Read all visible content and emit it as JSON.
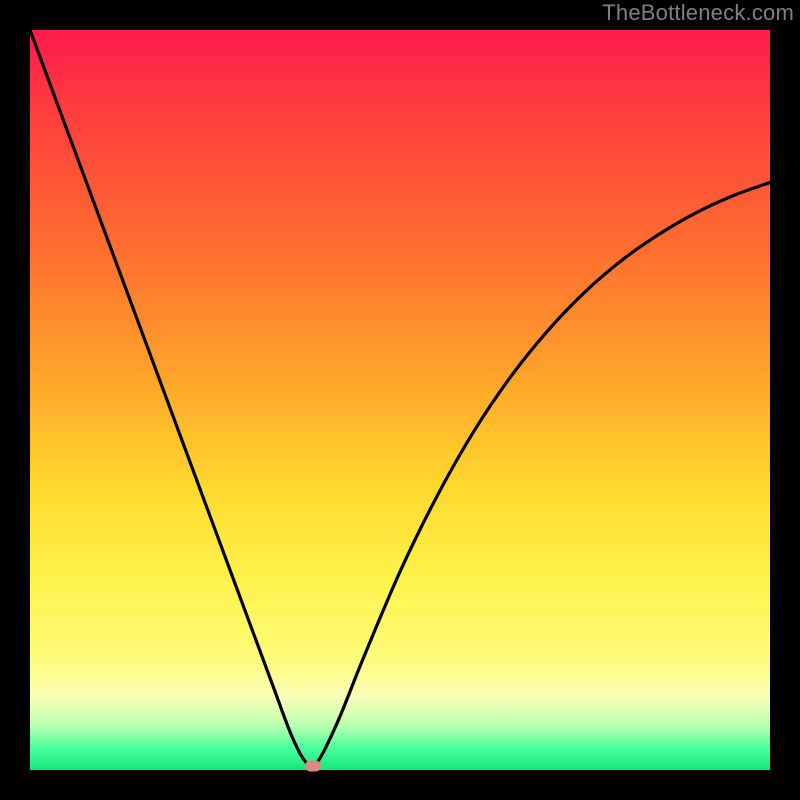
{
  "watermark": {
    "text": "TheBottleneck.com"
  },
  "colors": {
    "gradient_top": "#ff1a4d",
    "gradient_mid1": "#ffa82a",
    "gradient_mid2": "#fff24a",
    "gradient_bottom": "#15e67b",
    "curve": "#000000",
    "marker": "#d88a84",
    "frame": "#000000"
  },
  "chart_data": {
    "type": "line",
    "title": "",
    "xlabel": "",
    "ylabel": "",
    "xlim": [
      0,
      100
    ],
    "ylim": [
      0,
      100
    ],
    "grid": false,
    "legend": false,
    "annotations": [
      {
        "name": "watermark",
        "text": "TheBottleneck.com",
        "pos": "top-right"
      },
      {
        "name": "bottleneck-marker",
        "x": 38.2,
        "y": 0.5
      }
    ],
    "series": [
      {
        "name": "bottleneck-curve",
        "x": [
          0,
          5,
          10,
          15,
          20,
          25,
          30,
          33,
          35,
          36.5,
          37.5,
          38.2,
          39,
          40,
          42,
          45,
          50,
          55,
          60,
          65,
          70,
          75,
          80,
          85,
          90,
          95,
          100
        ],
        "y": [
          100,
          86.5,
          73.0,
          59.5,
          46.0,
          32.5,
          19.0,
          10.9,
          5.5,
          2.2,
          0.8,
          0.0,
          1.3,
          3.1,
          7.5,
          15.0,
          26.8,
          37.0,
          45.8,
          53.2,
          59.4,
          64.6,
          68.9,
          72.4,
          75.3,
          77.6,
          79.4
        ]
      }
    ],
    "marker": {
      "x": 38.2,
      "y": 0.5
    }
  }
}
